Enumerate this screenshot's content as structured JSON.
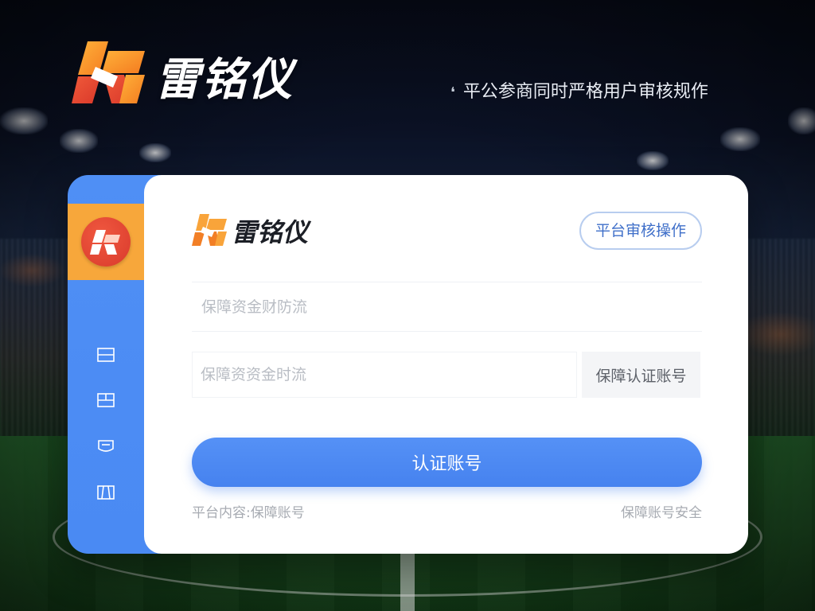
{
  "header": {
    "brand_name": "雷铭仪",
    "tagline": "平公参商同时严格用户审核规作"
  },
  "card": {
    "brand_name": "雷铭仪",
    "audit_button_label": "平台审核操作",
    "field1": {
      "placeholder": "保障资金财防流",
      "value": ""
    },
    "field2": {
      "placeholder": "保障资资金时流",
      "value": ""
    },
    "verify_button_label": "保障认证账号",
    "submit_button_label": "认证账号",
    "footer_left": "平台内容:保障账号",
    "footer_right": "保障账号安全"
  },
  "sidebar": {
    "items": [
      {
        "icon": "panel-icon"
      },
      {
        "icon": "window-icon"
      },
      {
        "icon": "tray-icon"
      },
      {
        "icon": "frame-icon"
      }
    ]
  },
  "colors": {
    "accent_blue": "#4a8af3",
    "logo_orange": "#f7a73b",
    "logo_red": "#e0452f"
  }
}
